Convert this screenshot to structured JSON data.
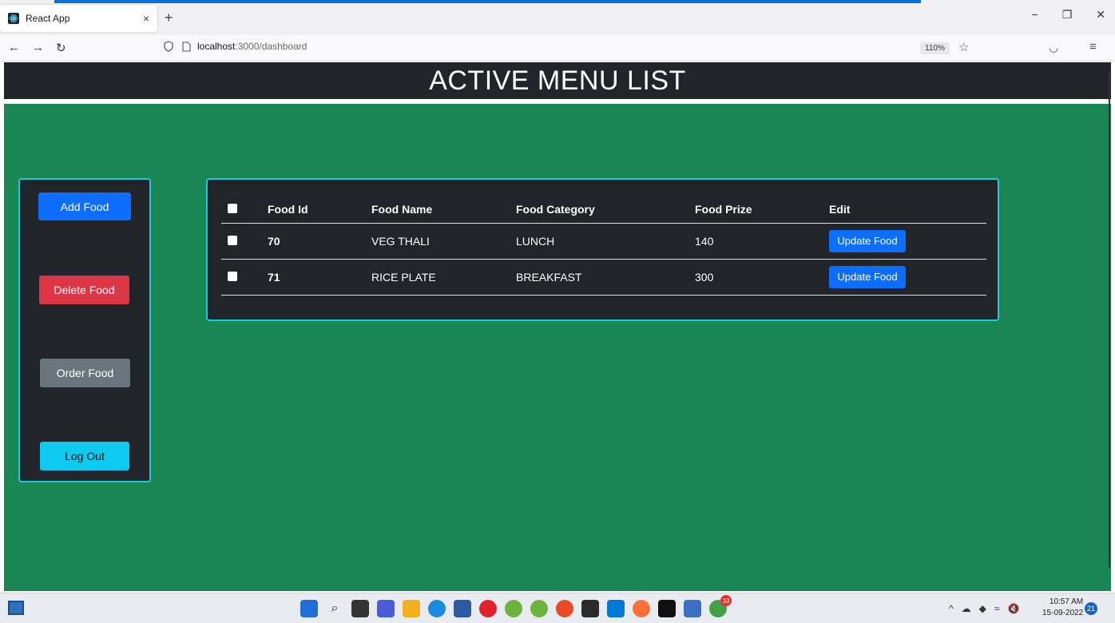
{
  "browser": {
    "tab_title": "React App",
    "tab_close": "×",
    "new_tab": "+",
    "url_host": "localhost",
    "url_path": ":3000/dashboard",
    "zoom": "110%",
    "window_controls": [
      "−",
      "❐",
      "✕"
    ]
  },
  "app": {
    "title": "ACTIVE MENU LIST",
    "colors": {
      "header_bg": "#212529",
      "main_bg": "#198754",
      "panel_border": "#1ec7e6",
      "primary": "#0d6efd",
      "danger": "#dc3545",
      "secondary": "#6c757d",
      "info": "#0dcaf0"
    },
    "sidebar": {
      "add_label": "Add Food",
      "delete_label": "Delete Food",
      "order_label": "Order Food",
      "logout_label": "Log Out"
    },
    "table": {
      "headers": [
        "Food Id",
        "Food Name",
        "Food Category",
        "Food Prize",
        "Edit"
      ],
      "rows": [
        {
          "id": "70",
          "name": "VEG THALI",
          "category": "LUNCH",
          "prize": "140",
          "action": "Update Food"
        },
        {
          "id": "71",
          "name": "RICE PLATE",
          "category": "BREAKFAST",
          "prize": "300",
          "action": "Update Food"
        }
      ]
    }
  },
  "taskbar": {
    "badge_count": "33",
    "time": "10:57 AM",
    "date": "15-09-2022",
    "notification_count": "21"
  }
}
